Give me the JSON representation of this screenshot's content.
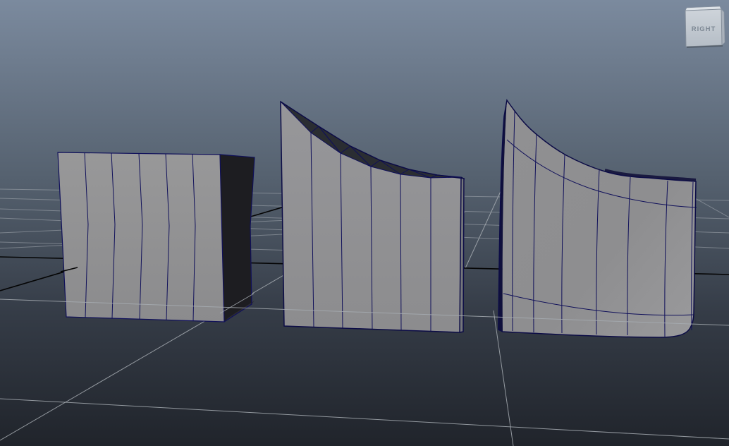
{
  "viewport": {
    "view_cube_label": "RIGHT"
  },
  "colors": {
    "bg-top": "#7b8a9e",
    "bg-upper": "#5d6a7a",
    "bg-lower": "#353c47",
    "bg-bottom": "#20242b",
    "grid-line": "#a6abb2",
    "axis-line": "#050505",
    "wire": "#10105a",
    "wire-dark": "#0c0c46",
    "face-light": "#949496",
    "face-shaded": "#8a8a8c",
    "face-dark-side": "#1d1d21",
    "face-bottom-sliver": "#2c2c31",
    "top-strip-dark": "#2a2d32",
    "side-strip": "#74767a",
    "sliver-navy": "#10103c",
    "viewcube-face-top": "#ced4da",
    "viewcube-face-bottom": "#b5bdc6",
    "viewcube-edge": "#8a94a0",
    "viewcube-text": "#7d8894"
  }
}
